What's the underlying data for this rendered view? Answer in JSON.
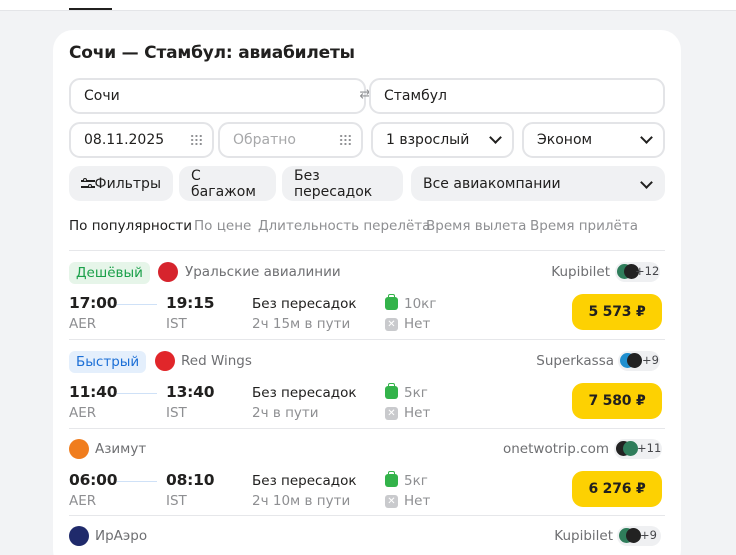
{
  "page": {
    "title": "Сочи — Стамбул: авиабилеты"
  },
  "search": {
    "from": "Сочи",
    "to": "Стамбул",
    "date_there": "08.11.2025",
    "date_back_placeholder": "Обратно",
    "passengers": "1 взрослый",
    "cabin_class": "Эконом"
  },
  "filters": {
    "filters_label": "Фильтры",
    "baggage_label": "С багажом",
    "direct_label": "Без пересадок",
    "airlines_label": "Все авиакомпании"
  },
  "sorting": {
    "options": [
      "По популярности",
      "По цене",
      "Длительность перелёта",
      "Время вылета",
      "Время прилёта"
    ],
    "active": "По популярности"
  },
  "icons": {
    "swap": "swap-arrows-icon",
    "calendar": "calendar-icon",
    "filters": "sliders-icon",
    "dropdown": "chevron-down-icon",
    "baggage": "suitcase-icon",
    "no_baggage": "no-suitcase-icon"
  },
  "colors": {
    "accent_price": "#fdd102",
    "cheap_badge": "#1ba04a",
    "fast_badge": "#1c6fd6",
    "baggage_green": "#33b34a"
  },
  "results": [
    {
      "badge": "Дешёвый",
      "airline": "Уральские авиалинии",
      "agent": "Kupibilet",
      "more_offers": "+12",
      "depart_time": "17:00",
      "arrive_time": "19:15",
      "depart_iata": "AER",
      "arrive_iata": "IST",
      "stops": "Без пересадок",
      "duration": "2ч 15м в пути",
      "baggage": "10кг",
      "no_baggage": "Нет",
      "price": "5 573 ₽"
    },
    {
      "badge": "Быстрый",
      "airline": "Red Wings",
      "agent": "Superkassa",
      "more_offers": "+9",
      "depart_time": "11:40",
      "arrive_time": "13:40",
      "depart_iata": "AER",
      "arrive_iata": "IST",
      "stops": "Без пересадок",
      "duration": "2ч в пути",
      "baggage": "5кг",
      "no_baggage": "Нет",
      "price": "7 580 ₽"
    },
    {
      "badge": "",
      "airline": "Азимут",
      "agent": "onetwotrip.com",
      "more_offers": "+11",
      "depart_time": "06:00",
      "arrive_time": "08:10",
      "depart_iata": "AER",
      "arrive_iata": "IST",
      "stops": "Без пересадок",
      "duration": "2ч 10м в пути",
      "baggage": "5кг",
      "no_baggage": "Нет",
      "price": "6 276 ₽"
    },
    {
      "badge": "",
      "airline": "ИрАэро",
      "agent": "Kupibilet",
      "more_offers": "+9"
    }
  ]
}
